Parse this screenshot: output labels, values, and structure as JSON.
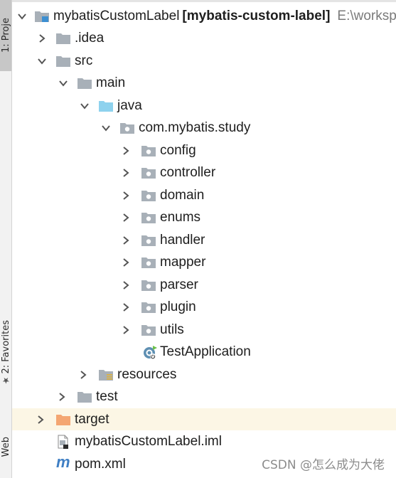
{
  "side_tabs": {
    "project": "1: Proje",
    "favorites": "2: Favorites",
    "web": "Web"
  },
  "tree": {
    "root": {
      "name": "mybatisCustomLabel",
      "module": "[mybatis-custom-label]",
      "path": "E:\\worksp"
    },
    "idea": ".idea",
    "src": "src",
    "main": "main",
    "java": "java",
    "package": "com.mybatis.study",
    "subpackages": [
      "config",
      "controller",
      "domain",
      "enums",
      "handler",
      "mapper",
      "parser",
      "plugin",
      "utils"
    ],
    "test_application": "TestApplication",
    "resources": "resources",
    "test": "test",
    "target": "target",
    "iml_file": "mybatisCustomLabel.iml",
    "pom_file": "pom.xml"
  },
  "watermark": "CSDN @怎么成为大佬",
  "colors": {
    "folder": "#a8b0b8",
    "source_folder": "#8ed2ee",
    "excluded_folder": "#f4a672",
    "selection_highlight": "#fcf6e5"
  }
}
